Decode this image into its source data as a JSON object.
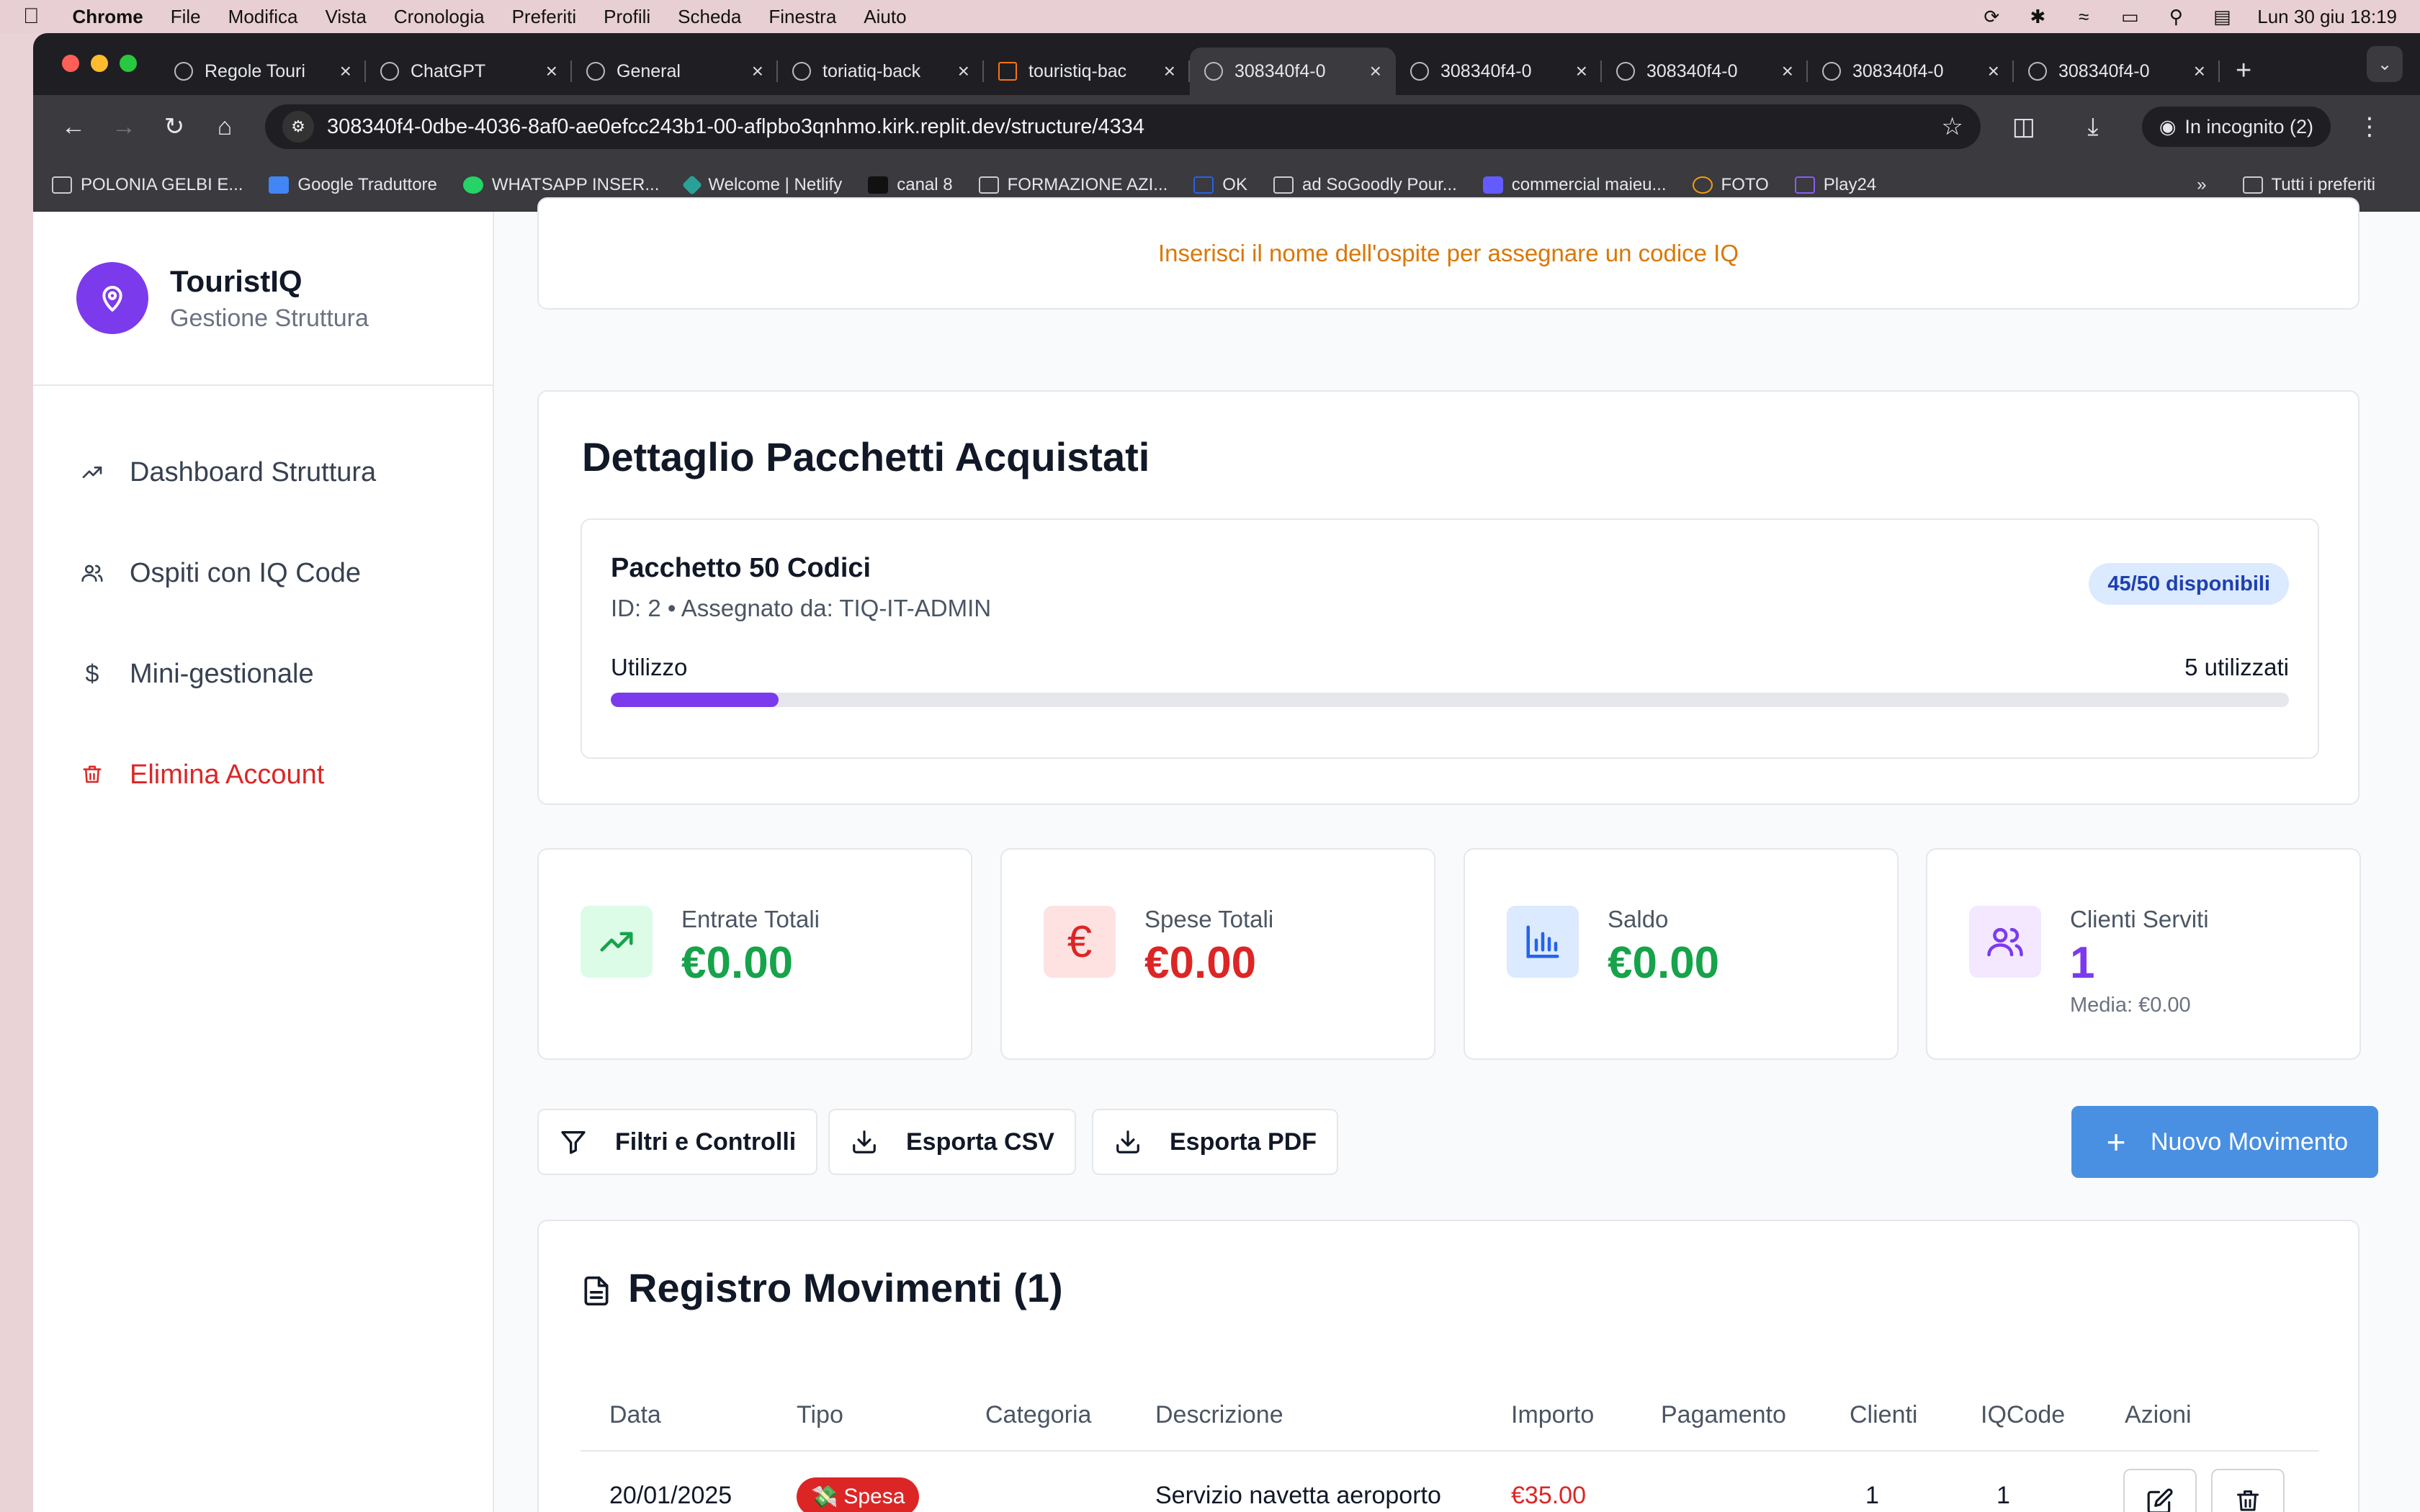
{
  "menubar": {
    "app": "Chrome",
    "items": [
      "File",
      "Modifica",
      "Vista",
      "Cronologia",
      "Preferiti",
      "Profili",
      "Scheda",
      "Finestra",
      "Aiuto"
    ],
    "clock": "Lun 30 giu  18:19"
  },
  "tabs": [
    {
      "label": "Regole Touri"
    },
    {
      "label": "ChatGPT"
    },
    {
      "label": "General"
    },
    {
      "label": "toriatiq-back"
    },
    {
      "label": "touristiq-bac"
    },
    {
      "label": "308340f4-0",
      "active": true
    },
    {
      "label": "308340f4-0"
    },
    {
      "label": "308340f4-0"
    },
    {
      "label": "308340f4-0"
    },
    {
      "label": "308340f4-0"
    }
  ],
  "url": "308340f4-0dbe-4036-8af0-ae0efcc243b1-00-aflpbo3qnhmo.kirk.replit.dev/structure/4334",
  "incognito_label": "In incognito (2)",
  "bookmarks": [
    "POLONIA GELBI E...",
    "Google Traduttore",
    "WHATSAPP INSER...",
    "Welcome | Netlify",
    "canal 8",
    "FORMAZIONE AZI...",
    "OK",
    "ad SoGoodly Pour...",
    "commercial maieu...",
    "FOTO",
    "Play24"
  ],
  "bookmarks_all": "Tutti i preferiti",
  "sidebar": {
    "brand_name": "TouristIQ",
    "brand_sub": "Gestione Struttura",
    "items": [
      {
        "label": "Dashboard Struttura",
        "icon": "trending-up-icon"
      },
      {
        "label": "Ospiti con IQ Code",
        "icon": "users-icon"
      },
      {
        "label": "Mini-gestionale",
        "icon": "dollar-icon"
      },
      {
        "label": "Elimina Account",
        "icon": "trash-icon"
      }
    ]
  },
  "hint": "Inserisci il nome dell'ospite per assegnare un codice IQ",
  "packages": {
    "title": "Dettaglio Pacchetti Acquistati",
    "name": "Pacchetto 50 Codici",
    "meta": "ID: 2 • Assegnato da: TIQ-IT-ADMIN",
    "badge": "45/50 disponibili",
    "usage_label": "Utilizzo",
    "usage_count": "5 utilizzati",
    "usage_fraction": 0.1
  },
  "stats": [
    {
      "label": "Entrate Totali",
      "value": "€0.00",
      "color": "#16a34a",
      "bg": "#dcfce7",
      "icon": "trending-up-icon"
    },
    {
      "label": "Spese Totali",
      "value": "€0.00",
      "color": "#dc2626",
      "bg": "#fee2e2",
      "icon": "euro-icon"
    },
    {
      "label": "Saldo",
      "value": "€0.00",
      "color": "#16a34a",
      "bg": "#dbeafe",
      "icon": "bar-chart-icon"
    },
    {
      "label": "Clienti Serviti",
      "value": "1",
      "sub": "Media: €0.00",
      "color": "#7c3aed",
      "bg": "#f3e8ff",
      "icon": "users-icon"
    }
  ],
  "actions": {
    "filters": "Filtri e Controlli",
    "csv": "Esporta CSV",
    "pdf": "Esporta PDF",
    "new": "Nuovo Movimento"
  },
  "register": {
    "title": "Registro Movimenti (1)",
    "columns": [
      "Data",
      "Tipo",
      "Categoria",
      "Descrizione",
      "Importo",
      "Pagamento",
      "Clienti",
      "IQCode",
      "Azioni"
    ],
    "rows": [
      {
        "date": "20/01/2025",
        "type": "Spesa",
        "type_emoji": "💸",
        "category": "",
        "description": "Servizio navetta aeroporto",
        "amount": "€35.00",
        "payment": "",
        "clients": "1",
        "iqcode": "1"
      }
    ]
  },
  "colors": {
    "accent": "#7c3aed",
    "primary_button": "#4a90e2",
    "danger": "#dc2626",
    "warning": "#d97706"
  }
}
